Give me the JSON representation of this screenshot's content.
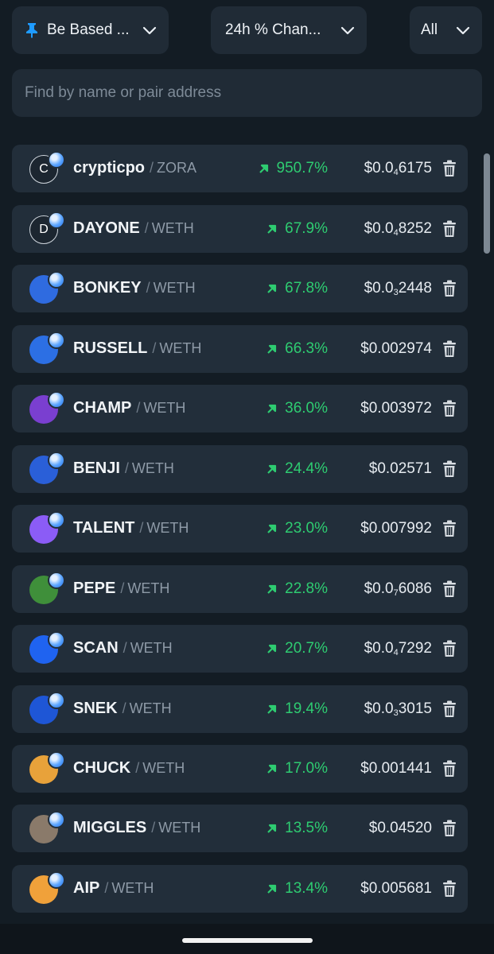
{
  "filters": {
    "watchlist_label": "Be Based ...",
    "sort_label": "24h % Chan...",
    "scope_label": "All"
  },
  "search": {
    "placeholder": "Find by name or pair address",
    "value": ""
  },
  "colors": {
    "background": "#131c24",
    "card": "#222e3a",
    "positive": "#2ecc71",
    "muted": "#8e9aa7",
    "badge": "#3b8bff"
  },
  "icons": {
    "watchlist": "pin-icon",
    "dropdown": "chevron-down-icon",
    "change": "arrow-up-right-icon",
    "remove": "trash-icon",
    "chain_badge": "base-chain-icon"
  },
  "tokens": [
    {
      "symbol": "crypticpo",
      "quote": "ZORA",
      "change": "950.7%",
      "price_prefix": "$0.0",
      "price_zeros": "4",
      "price_digits": "6175",
      "avatar_letter": "C",
      "avatar_color": "#1c2630"
    },
    {
      "symbol": "DAYONE",
      "quote": "WETH",
      "change": "67.9%",
      "price_prefix": "$0.0",
      "price_zeros": "4",
      "price_digits": "8252",
      "avatar_letter": "D",
      "avatar_color": "#1c2630"
    },
    {
      "symbol": "BONKEY",
      "quote": "WETH",
      "change": "67.8%",
      "price_prefix": "$0.0",
      "price_zeros": "3",
      "price_digits": "2448",
      "avatar_letter": "",
      "avatar_color": "#2f6be0"
    },
    {
      "symbol": "RUSSELL",
      "quote": "WETH",
      "change": "66.3%",
      "price_prefix": "$0.002974",
      "price_zeros": "",
      "price_digits": "",
      "avatar_letter": "",
      "avatar_color": "#2c6fe4"
    },
    {
      "symbol": "CHAMP",
      "quote": "WETH",
      "change": "36.0%",
      "price_prefix": "$0.003972",
      "price_zeros": "",
      "price_digits": "",
      "avatar_letter": "",
      "avatar_color": "#7a3fd0"
    },
    {
      "symbol": "BENJI",
      "quote": "WETH",
      "change": "24.4%",
      "price_prefix": "$0.02571",
      "price_zeros": "",
      "price_digits": "",
      "avatar_letter": "",
      "avatar_color": "#2a5fd8"
    },
    {
      "symbol": "TALENT",
      "quote": "WETH",
      "change": "23.0%",
      "price_prefix": "$0.007992",
      "price_zeros": "",
      "price_digits": "",
      "avatar_letter": "",
      "avatar_color": "#8b5cf6"
    },
    {
      "symbol": "PEPE",
      "quote": "WETH",
      "change": "22.8%",
      "price_prefix": "$0.0",
      "price_zeros": "7",
      "price_digits": "6086",
      "avatar_letter": "",
      "avatar_color": "#3f8f3a"
    },
    {
      "symbol": "SCAN",
      "quote": "WETH",
      "change": "20.7%",
      "price_prefix": "$0.0",
      "price_zeros": "4",
      "price_digits": "7292",
      "avatar_letter": "",
      "avatar_color": "#1f63f0"
    },
    {
      "symbol": "SNEK",
      "quote": "WETH",
      "change": "19.4%",
      "price_prefix": "$0.0",
      "price_zeros": "3",
      "price_digits": "3015",
      "avatar_letter": "",
      "avatar_color": "#1e56d6"
    },
    {
      "symbol": "CHUCK",
      "quote": "WETH",
      "change": "17.0%",
      "price_prefix": "$0.001441",
      "price_zeros": "",
      "price_digits": "",
      "avatar_letter": "",
      "avatar_color": "#e8a23a"
    },
    {
      "symbol": "MIGGLES",
      "quote": "WETH",
      "change": "13.5%",
      "price_prefix": "$0.04520",
      "price_zeros": "",
      "price_digits": "",
      "avatar_letter": "",
      "avatar_color": "#8a7a6a"
    },
    {
      "symbol": "AIP",
      "quote": "WETH",
      "change": "13.4%",
      "price_prefix": "$0.005681",
      "price_zeros": "",
      "price_digits": "",
      "avatar_letter": "",
      "avatar_color": "#f0a13a"
    }
  ]
}
